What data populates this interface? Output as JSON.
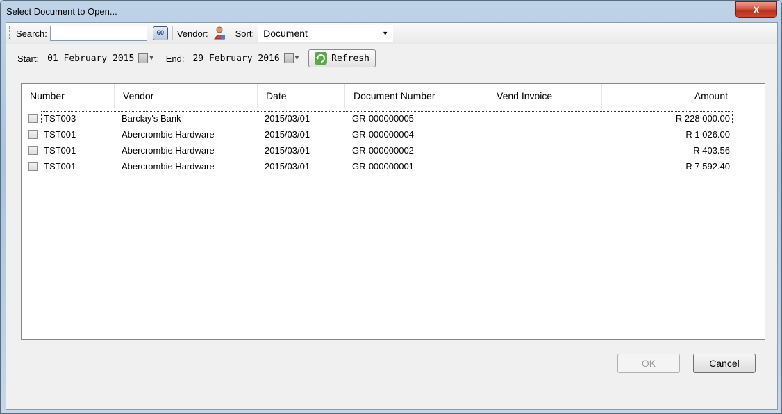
{
  "window": {
    "title": "Select Document to Open...",
    "close_label": "X"
  },
  "toolbar": {
    "search_label": "Search:",
    "search_value": "",
    "go_label": "GO",
    "vendor_label": "Vendor:",
    "sort_label": "Sort:",
    "sort_value": "Document"
  },
  "dates": {
    "start_label": "Start:",
    "start_value": "01  February  2015",
    "end_label": "End:",
    "end_value": "29  February  2016",
    "refresh_label": "Refresh"
  },
  "table": {
    "columns": [
      "Number",
      "Vendor",
      "Date",
      "Document Number",
      "Vend Invoice",
      "Amount"
    ],
    "rows": [
      {
        "number": "TST003",
        "vendor": "Barclay's Bank",
        "date": "2015/03/01",
        "doc": "GR-000000005",
        "invoice": "",
        "amount": "R 228 000.00",
        "checked": false
      },
      {
        "number": "TST001",
        "vendor": "Abercrombie Hardware",
        "date": "2015/03/01",
        "doc": "GR-000000004",
        "invoice": "",
        "amount": "R 1 026.00",
        "checked": false
      },
      {
        "number": "TST001",
        "vendor": "Abercrombie Hardware",
        "date": "2015/03/01",
        "doc": "GR-000000002",
        "invoice": "",
        "amount": "R 403.56",
        "checked": false
      },
      {
        "number": "TST001",
        "vendor": "Abercrombie Hardware",
        "date": "2015/03/01",
        "doc": "GR-000000001",
        "invoice": "",
        "amount": "R 7 592.40",
        "checked": false
      }
    ]
  },
  "buttons": {
    "ok_label": "OK",
    "cancel_label": "Cancel"
  },
  "colors": {
    "close_red": "#c94a30",
    "refresh_green": "#5aa84a",
    "selection_border": "#333333"
  }
}
